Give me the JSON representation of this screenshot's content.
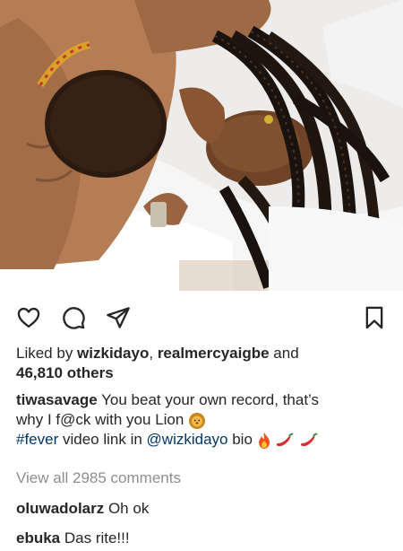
{
  "post": {
    "photo": {
      "alt_subject": "photo-couple-lying-on-white-sheets"
    },
    "actions": {
      "like_icon": "heart-outline-icon",
      "comment_icon": "comment-bubble-icon",
      "share_icon": "paper-plane-icon",
      "save_icon": "bookmark-icon"
    },
    "likes": {
      "prefix": "Liked by ",
      "user1": "wizkidayo",
      "separator": ", ",
      "user2": "realmercyaigbe",
      "and": " and",
      "count": "46,810 others"
    },
    "caption": {
      "username": "tiwasavage",
      "text_line1": " You beat your own record, that’s",
      "text_line2": "why I f@ck with you Lion",
      "hashtag": "#fever",
      "mid": " video link in ",
      "mention": "@wizkidayo",
      "end": " bio"
    },
    "view_all_comments": "View all 2985 comments",
    "comments": [
      {
        "username": "oluwadolarz",
        "text": " Oh ok"
      },
      {
        "username": "ebuka",
        "text": " Das rite!!!"
      }
    ],
    "colors": {
      "text": "#262626",
      "link": "#00376b",
      "muted": "#8e8e8e"
    }
  }
}
